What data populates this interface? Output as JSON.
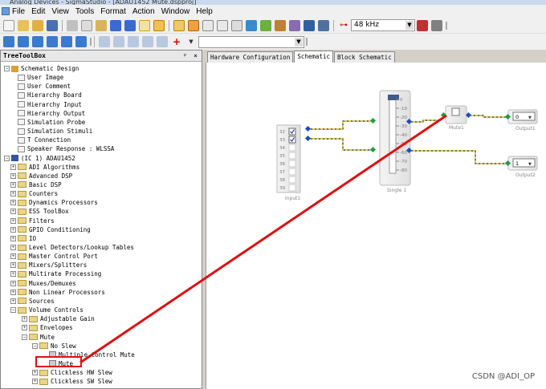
{
  "window": {
    "title": "Analog Devices - SigmaStudio - [ADAU1452 Mute.dspproj]"
  },
  "menu": [
    "File",
    "Edit",
    "View",
    "Tools",
    "Format",
    "Action",
    "Window",
    "Help"
  ],
  "toolbar": {
    "sample_rate": "48 kHz"
  },
  "toolbox": {
    "title": "TreeToolBox",
    "pin": "ᵖ",
    "close": "×",
    "items": [
      {
        "label": "Schematic Design",
        "level": 0,
        "kind": "root",
        "expander": "−"
      },
      {
        "label": "User Image",
        "level": 1,
        "kind": "leaf"
      },
      {
        "label": "User Comment",
        "level": 1,
        "kind": "leaf"
      },
      {
        "label": "Hierarchy Board",
        "level": 1,
        "kind": "leaf"
      },
      {
        "label": "Hierarchy Input",
        "level": 1,
        "kind": "leaf"
      },
      {
        "label": "Hierarchy Output",
        "level": 1,
        "kind": "leaf"
      },
      {
        "label": "Simulation Probe",
        "level": 1,
        "kind": "leaf"
      },
      {
        "label": "Simulation Stimuli",
        "level": 1,
        "kind": "leaf"
      },
      {
        "label": "T Connection",
        "level": 1,
        "kind": "leaf"
      },
      {
        "label": "Speaker Response : WLSSA",
        "level": 1,
        "kind": "leaf"
      },
      {
        "label": "(IC 1) ADAU1452",
        "level": 0,
        "kind": "chip",
        "expander": "−"
      },
      {
        "label": "ADI Algorithms",
        "level": 1,
        "kind": "folder",
        "expander": "+"
      },
      {
        "label": "Advanced DSP",
        "level": 1,
        "kind": "folder",
        "expander": "+"
      },
      {
        "label": "Basic DSP",
        "level": 1,
        "kind": "folder",
        "expander": "+"
      },
      {
        "label": "Counters",
        "level": 1,
        "kind": "folder",
        "expander": "+"
      },
      {
        "label": "Dynamics Processors",
        "level": 1,
        "kind": "folder",
        "expander": "+"
      },
      {
        "label": "ESS ToolBox",
        "level": 1,
        "kind": "folder",
        "expander": "+"
      },
      {
        "label": "Filters",
        "level": 1,
        "kind": "folder",
        "expander": "+"
      },
      {
        "label": "GPIO Conditioning",
        "level": 1,
        "kind": "folder",
        "expander": "+"
      },
      {
        "label": "IO",
        "level": 1,
        "kind": "folder",
        "expander": "+"
      },
      {
        "label": "Level Detectors/Lookup Tables",
        "level": 1,
        "kind": "folder",
        "expander": "+"
      },
      {
        "label": "Master Control Port",
        "level": 1,
        "kind": "folder",
        "expander": "+"
      },
      {
        "label": "Mixers/Splitters",
        "level": 1,
        "kind": "folder",
        "expander": "+"
      },
      {
        "label": "Multirate Processing",
        "level": 1,
        "kind": "folder",
        "expander": "+"
      },
      {
        "label": "Muxes/Demuxes",
        "level": 1,
        "kind": "folder",
        "expander": "+"
      },
      {
        "label": "Non Linear Processors",
        "level": 1,
        "kind": "folder",
        "expander": "+"
      },
      {
        "label": "Sources",
        "level": 1,
        "kind": "folder",
        "expander": "+"
      },
      {
        "label": "Volume Controls",
        "level": 1,
        "kind": "folder",
        "expander": "−"
      },
      {
        "label": "Adjustable Gain",
        "level": 2,
        "kind": "folder",
        "expander": "+"
      },
      {
        "label": "Envelopes",
        "level": 2,
        "kind": "folder",
        "expander": "+"
      },
      {
        "label": "Mute",
        "level": 2,
        "kind": "folder",
        "expander": "−"
      },
      {
        "label": "No Slew",
        "level": 3,
        "kind": "folder",
        "expander": "−"
      },
      {
        "label": "Multiple Control Mute",
        "level": 4,
        "kind": "module"
      },
      {
        "label": "Mute",
        "level": 4,
        "kind": "module"
      },
      {
        "label": "Clickless HW Slew",
        "level": 3,
        "kind": "folder",
        "expander": "+"
      },
      {
        "label": "Clickless SW Slew",
        "level": 3,
        "kind": "folder",
        "expander": "+"
      }
    ]
  },
  "tabs": [
    {
      "label": "Hardware Configuration",
      "active": false
    },
    {
      "label": "Schematic",
      "active": true
    },
    {
      "label": "Block Schematic",
      "active": false
    }
  ],
  "schematic": {
    "input": {
      "name": "Input1",
      "channels": [
        "32",
        "33",
        "34",
        "35",
        "36",
        "37",
        "38",
        "39"
      ],
      "checked": [
        true,
        true,
        false,
        false,
        false,
        false,
        false,
        false
      ]
    },
    "slider": {
      "name": "Single 1",
      "ticks": [
        "0",
        "-10",
        "-20",
        "-30",
        "-40",
        "-50",
        "-60",
        "-70",
        "-80"
      ]
    },
    "mute": {
      "name": "Mute1"
    },
    "outputs": [
      {
        "name": "Output1",
        "value": "0"
      },
      {
        "name": "Output2",
        "value": "1"
      }
    ]
  },
  "watermark": "CSDN @ADI_OP"
}
